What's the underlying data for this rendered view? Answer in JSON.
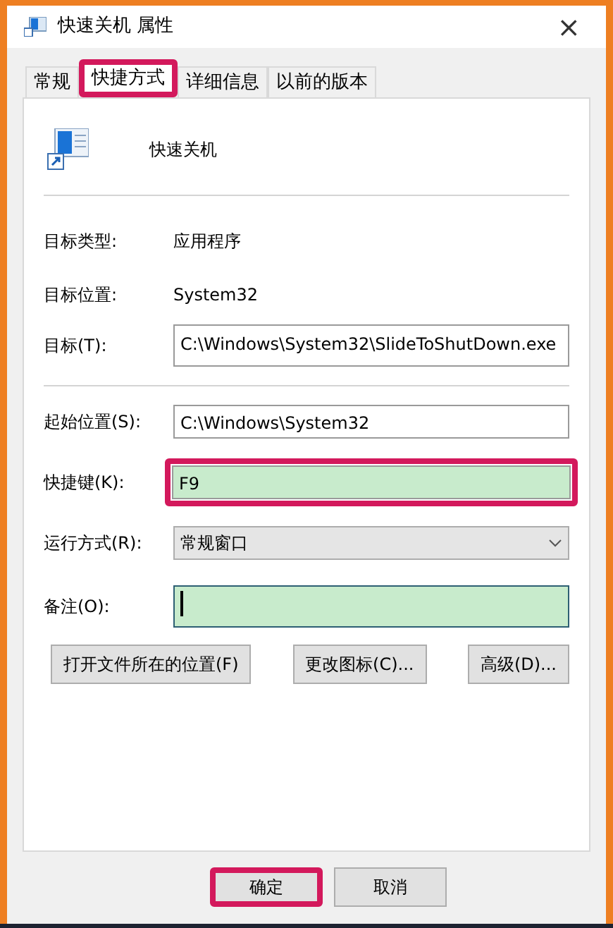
{
  "window": {
    "title": "快速关机 属性",
    "close": "×"
  },
  "tabs": [
    {
      "label": "常规",
      "selected": false,
      "highlighted": false
    },
    {
      "label": "快捷方式",
      "selected": true,
      "highlighted": true
    },
    {
      "label": "详细信息",
      "selected": false,
      "highlighted": false
    },
    {
      "label": "以前的版本",
      "selected": false,
      "highlighted": false
    }
  ],
  "app_name": "快速关机",
  "info": [
    {
      "label": "目标类型:",
      "value": "应用程序"
    },
    {
      "label": "目标位置:",
      "value": "System32"
    }
  ],
  "target": {
    "label": "目标(T):",
    "value": "C:\\Windows\\System32\\SlideToShutDown.exe"
  },
  "fields": [
    {
      "kind": "text",
      "label": "起始位置(S):",
      "value": "C:\\Windows\\System32",
      "highlighted": false
    },
    {
      "kind": "hotkey",
      "label": "快捷键(K):",
      "value": "F9",
      "highlighted": true
    },
    {
      "kind": "select",
      "label": "运行方式(R):",
      "value": "常规窗口",
      "highlighted": false
    },
    {
      "kind": "note",
      "label": "备注(O):",
      "highlighted": false
    }
  ],
  "buttons": [
    "打开文件所在的位置(F)",
    "更改图标(C)...",
    "高级(D)..."
  ],
  "dialog_buttons": [
    {
      "label": "确定",
      "highlighted": true
    },
    {
      "label": "取消",
      "highlighted": false
    }
  ]
}
